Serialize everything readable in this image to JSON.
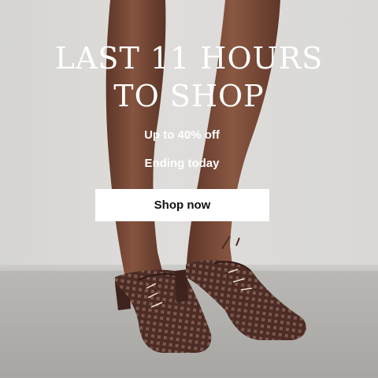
{
  "promo": {
    "headline_line1": "LAST 11 HOURS",
    "headline_line2": "TO SHOP",
    "offer": "Up to 40% off",
    "ending": "Ending today",
    "cta_label": "Shop now"
  },
  "colors": {
    "text": "#ffffff",
    "button_bg": "#ffffff",
    "button_text": "#111111",
    "skin": "#7a4a38",
    "shoe": "#4a2a24"
  }
}
